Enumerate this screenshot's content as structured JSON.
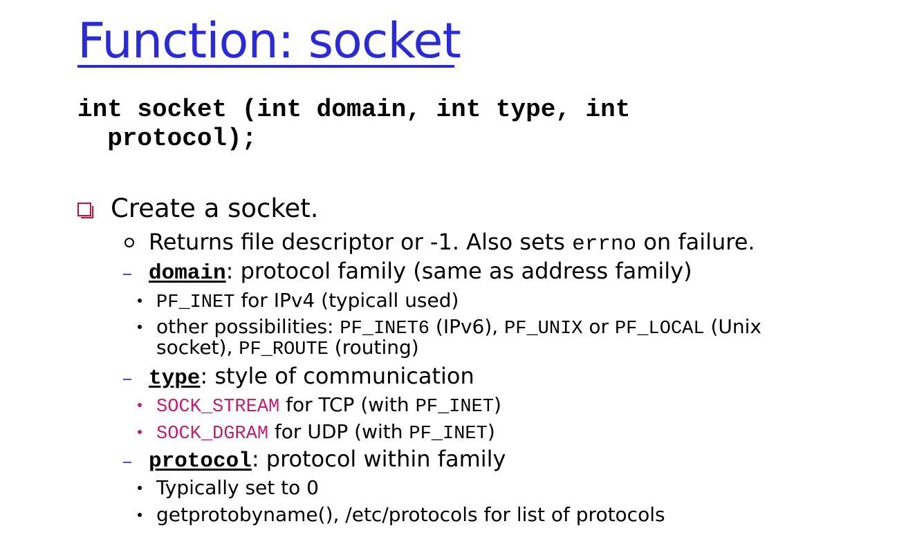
{
  "slide": {
    "title": "Function: socket",
    "signature_line1": "int socket (int domain, int type, int",
    "signature_line2": "  protocol);",
    "main_bullet": "Create a socket.",
    "returns": {
      "prefix": "Returns file descriptor or -1. Also sets ",
      "code": "errno",
      "suffix": " on failure."
    },
    "domain": {
      "kw": "domain",
      "text": ": protocol family (same as address family)",
      "item1_code": "PF_INET",
      "item1_text": " for IPv4 (typicall used)",
      "item2_part1": "other possibilities: ",
      "item2_code1": "PF_INET6",
      "item2_part2": " (IPv6), ",
      "item2_code2": "PF_UNIX",
      "item2_part3": " or ",
      "item2_code3": "PF_LOCAL",
      "item2_part4": " (Unix",
      "item2_line2_part1": "socket), ",
      "item2_code4": "PF_ROUTE",
      "item2_line2_part2": " (routing)"
    },
    "type": {
      "kw": "type",
      "text": ": style of communication",
      "item1_code": "SOCK_STREAM",
      "item1_text1": " for TCP (with ",
      "item1_code2": "PF_INET",
      "item1_text2": ")",
      "item2_code": "SOCK_DGRAM",
      "item2_text1": " for UDP (with ",
      "item2_code2": "PF_INET",
      "item2_text2": ")"
    },
    "protocol": {
      "kw": "protocol",
      "text": ": protocol within family",
      "item1": "Typically set to 0",
      "item2": "getprotobyname(), /etc/protocols for list of protocols"
    }
  },
  "colors": {
    "title": "#2a2ad8",
    "box_bullet": "#c0143c",
    "dash_bullet": "#4b4bd0",
    "sock_constants": "#c02070"
  }
}
